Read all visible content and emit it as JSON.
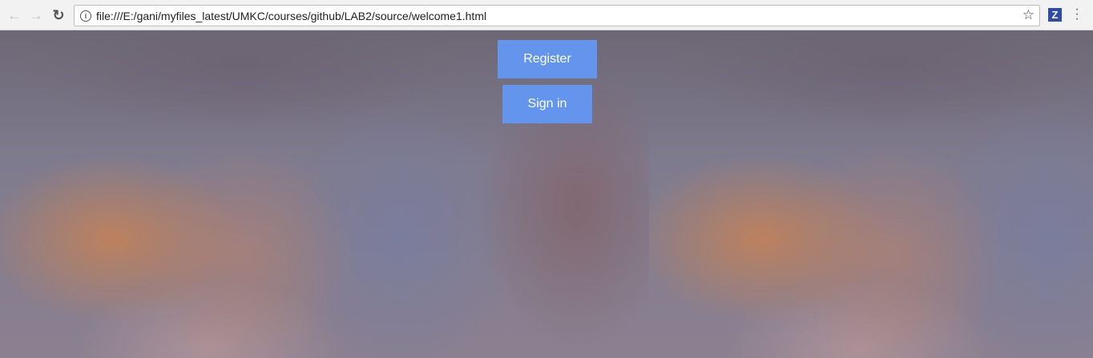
{
  "browser": {
    "url": "file:///E:/gani/myfiles_latest/UMKC/courses/github/LAB2/source/welcome1.html",
    "extension_label": "Z",
    "accent": "#6495ed"
  },
  "main": {
    "register_label": "Register",
    "signin_label": "Sign in"
  }
}
